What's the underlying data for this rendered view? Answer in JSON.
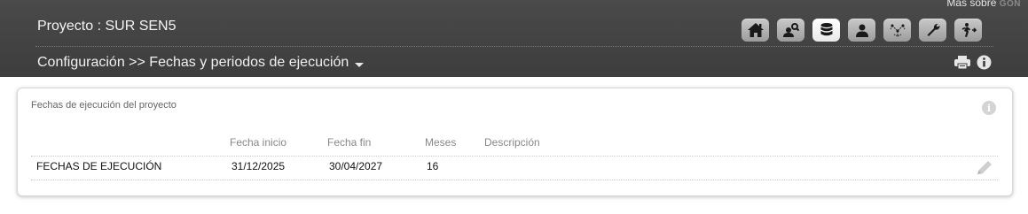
{
  "header": {
    "mas_sobre": "Más sobre",
    "brand": "GON",
    "project": "Proyecto : SUR SEN5",
    "breadcrumb": "Configuración >> Fechas y periodos de ejecución",
    "toolbar": [
      {
        "name": "home-icon"
      },
      {
        "name": "users-search-icon"
      },
      {
        "name": "database-icon",
        "active": true
      },
      {
        "name": "user-icon"
      },
      {
        "name": "tree-icon"
      },
      {
        "name": "wrench-icon"
      },
      {
        "name": "exit-icon"
      }
    ]
  },
  "panel": {
    "title": "Fechas de ejecución del proyecto",
    "info_glyph": "i",
    "columns": {
      "inicio": "Fecha inicio",
      "fin": "Fecha fin",
      "meses": "Meses",
      "descripcion": "Descripción"
    },
    "rows": [
      {
        "name": "FECHAS DE EJECUCIÓN",
        "inicio": "31/12/2025",
        "fin": "30/04/2027",
        "meses": "16",
        "descripcion": ""
      }
    ]
  }
}
